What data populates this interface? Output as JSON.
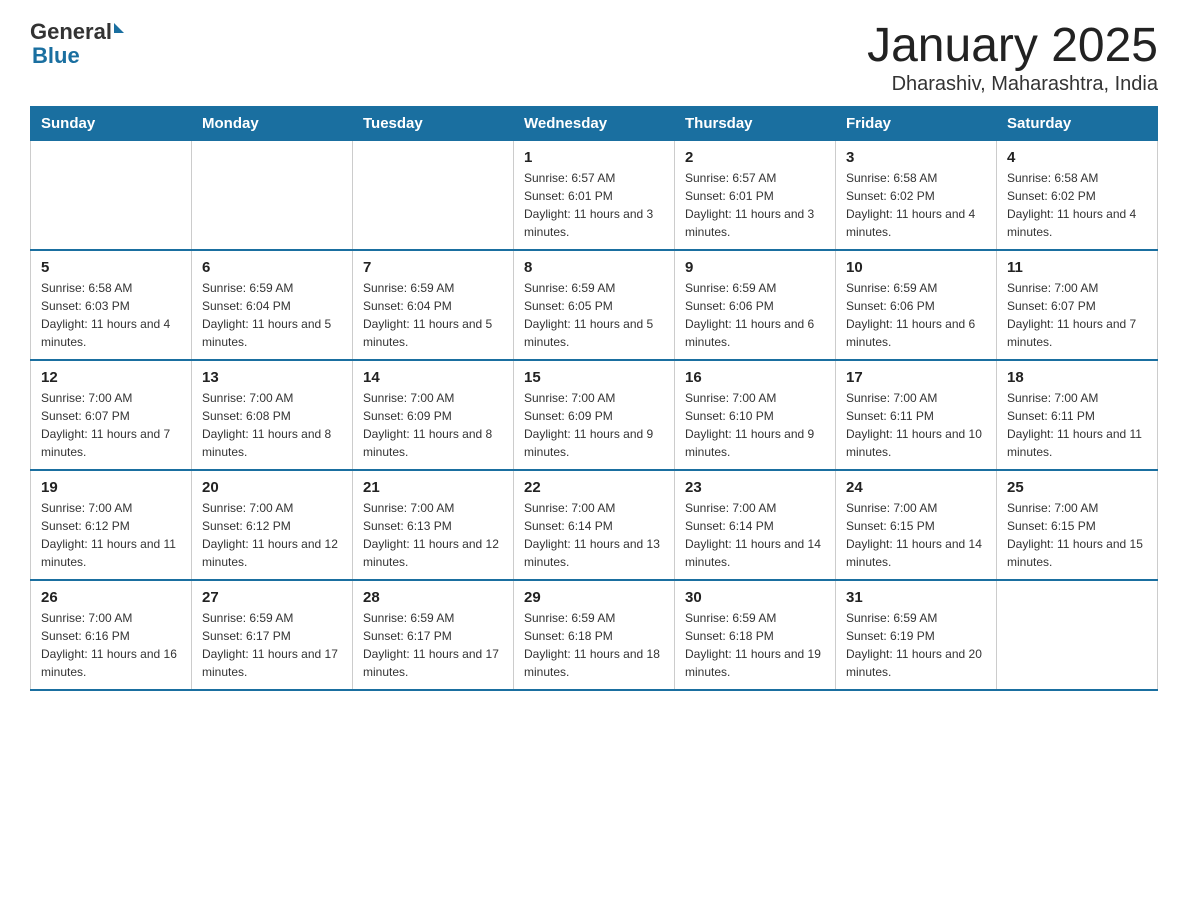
{
  "header": {
    "logo_general": "General",
    "logo_blue": "Blue",
    "title": "January 2025",
    "subtitle": "Dharashiv, Maharashtra, India"
  },
  "calendar": {
    "days_of_week": [
      "Sunday",
      "Monday",
      "Tuesday",
      "Wednesday",
      "Thursday",
      "Friday",
      "Saturday"
    ],
    "weeks": [
      [
        {
          "day": "",
          "info": ""
        },
        {
          "day": "",
          "info": ""
        },
        {
          "day": "",
          "info": ""
        },
        {
          "day": "1",
          "info": "Sunrise: 6:57 AM\nSunset: 6:01 PM\nDaylight: 11 hours and 3 minutes."
        },
        {
          "day": "2",
          "info": "Sunrise: 6:57 AM\nSunset: 6:01 PM\nDaylight: 11 hours and 3 minutes."
        },
        {
          "day": "3",
          "info": "Sunrise: 6:58 AM\nSunset: 6:02 PM\nDaylight: 11 hours and 4 minutes."
        },
        {
          "day": "4",
          "info": "Sunrise: 6:58 AM\nSunset: 6:02 PM\nDaylight: 11 hours and 4 minutes."
        }
      ],
      [
        {
          "day": "5",
          "info": "Sunrise: 6:58 AM\nSunset: 6:03 PM\nDaylight: 11 hours and 4 minutes."
        },
        {
          "day": "6",
          "info": "Sunrise: 6:59 AM\nSunset: 6:04 PM\nDaylight: 11 hours and 5 minutes."
        },
        {
          "day": "7",
          "info": "Sunrise: 6:59 AM\nSunset: 6:04 PM\nDaylight: 11 hours and 5 minutes."
        },
        {
          "day": "8",
          "info": "Sunrise: 6:59 AM\nSunset: 6:05 PM\nDaylight: 11 hours and 5 minutes."
        },
        {
          "day": "9",
          "info": "Sunrise: 6:59 AM\nSunset: 6:06 PM\nDaylight: 11 hours and 6 minutes."
        },
        {
          "day": "10",
          "info": "Sunrise: 6:59 AM\nSunset: 6:06 PM\nDaylight: 11 hours and 6 minutes."
        },
        {
          "day": "11",
          "info": "Sunrise: 7:00 AM\nSunset: 6:07 PM\nDaylight: 11 hours and 7 minutes."
        }
      ],
      [
        {
          "day": "12",
          "info": "Sunrise: 7:00 AM\nSunset: 6:07 PM\nDaylight: 11 hours and 7 minutes."
        },
        {
          "day": "13",
          "info": "Sunrise: 7:00 AM\nSunset: 6:08 PM\nDaylight: 11 hours and 8 minutes."
        },
        {
          "day": "14",
          "info": "Sunrise: 7:00 AM\nSunset: 6:09 PM\nDaylight: 11 hours and 8 minutes."
        },
        {
          "day": "15",
          "info": "Sunrise: 7:00 AM\nSunset: 6:09 PM\nDaylight: 11 hours and 9 minutes."
        },
        {
          "day": "16",
          "info": "Sunrise: 7:00 AM\nSunset: 6:10 PM\nDaylight: 11 hours and 9 minutes."
        },
        {
          "day": "17",
          "info": "Sunrise: 7:00 AM\nSunset: 6:11 PM\nDaylight: 11 hours and 10 minutes."
        },
        {
          "day": "18",
          "info": "Sunrise: 7:00 AM\nSunset: 6:11 PM\nDaylight: 11 hours and 11 minutes."
        }
      ],
      [
        {
          "day": "19",
          "info": "Sunrise: 7:00 AM\nSunset: 6:12 PM\nDaylight: 11 hours and 11 minutes."
        },
        {
          "day": "20",
          "info": "Sunrise: 7:00 AM\nSunset: 6:12 PM\nDaylight: 11 hours and 12 minutes."
        },
        {
          "day": "21",
          "info": "Sunrise: 7:00 AM\nSunset: 6:13 PM\nDaylight: 11 hours and 12 minutes."
        },
        {
          "day": "22",
          "info": "Sunrise: 7:00 AM\nSunset: 6:14 PM\nDaylight: 11 hours and 13 minutes."
        },
        {
          "day": "23",
          "info": "Sunrise: 7:00 AM\nSunset: 6:14 PM\nDaylight: 11 hours and 14 minutes."
        },
        {
          "day": "24",
          "info": "Sunrise: 7:00 AM\nSunset: 6:15 PM\nDaylight: 11 hours and 14 minutes."
        },
        {
          "day": "25",
          "info": "Sunrise: 7:00 AM\nSunset: 6:15 PM\nDaylight: 11 hours and 15 minutes."
        }
      ],
      [
        {
          "day": "26",
          "info": "Sunrise: 7:00 AM\nSunset: 6:16 PM\nDaylight: 11 hours and 16 minutes."
        },
        {
          "day": "27",
          "info": "Sunrise: 6:59 AM\nSunset: 6:17 PM\nDaylight: 11 hours and 17 minutes."
        },
        {
          "day": "28",
          "info": "Sunrise: 6:59 AM\nSunset: 6:17 PM\nDaylight: 11 hours and 17 minutes."
        },
        {
          "day": "29",
          "info": "Sunrise: 6:59 AM\nSunset: 6:18 PM\nDaylight: 11 hours and 18 minutes."
        },
        {
          "day": "30",
          "info": "Sunrise: 6:59 AM\nSunset: 6:18 PM\nDaylight: 11 hours and 19 minutes."
        },
        {
          "day": "31",
          "info": "Sunrise: 6:59 AM\nSunset: 6:19 PM\nDaylight: 11 hours and 20 minutes."
        },
        {
          "day": "",
          "info": ""
        }
      ]
    ]
  }
}
